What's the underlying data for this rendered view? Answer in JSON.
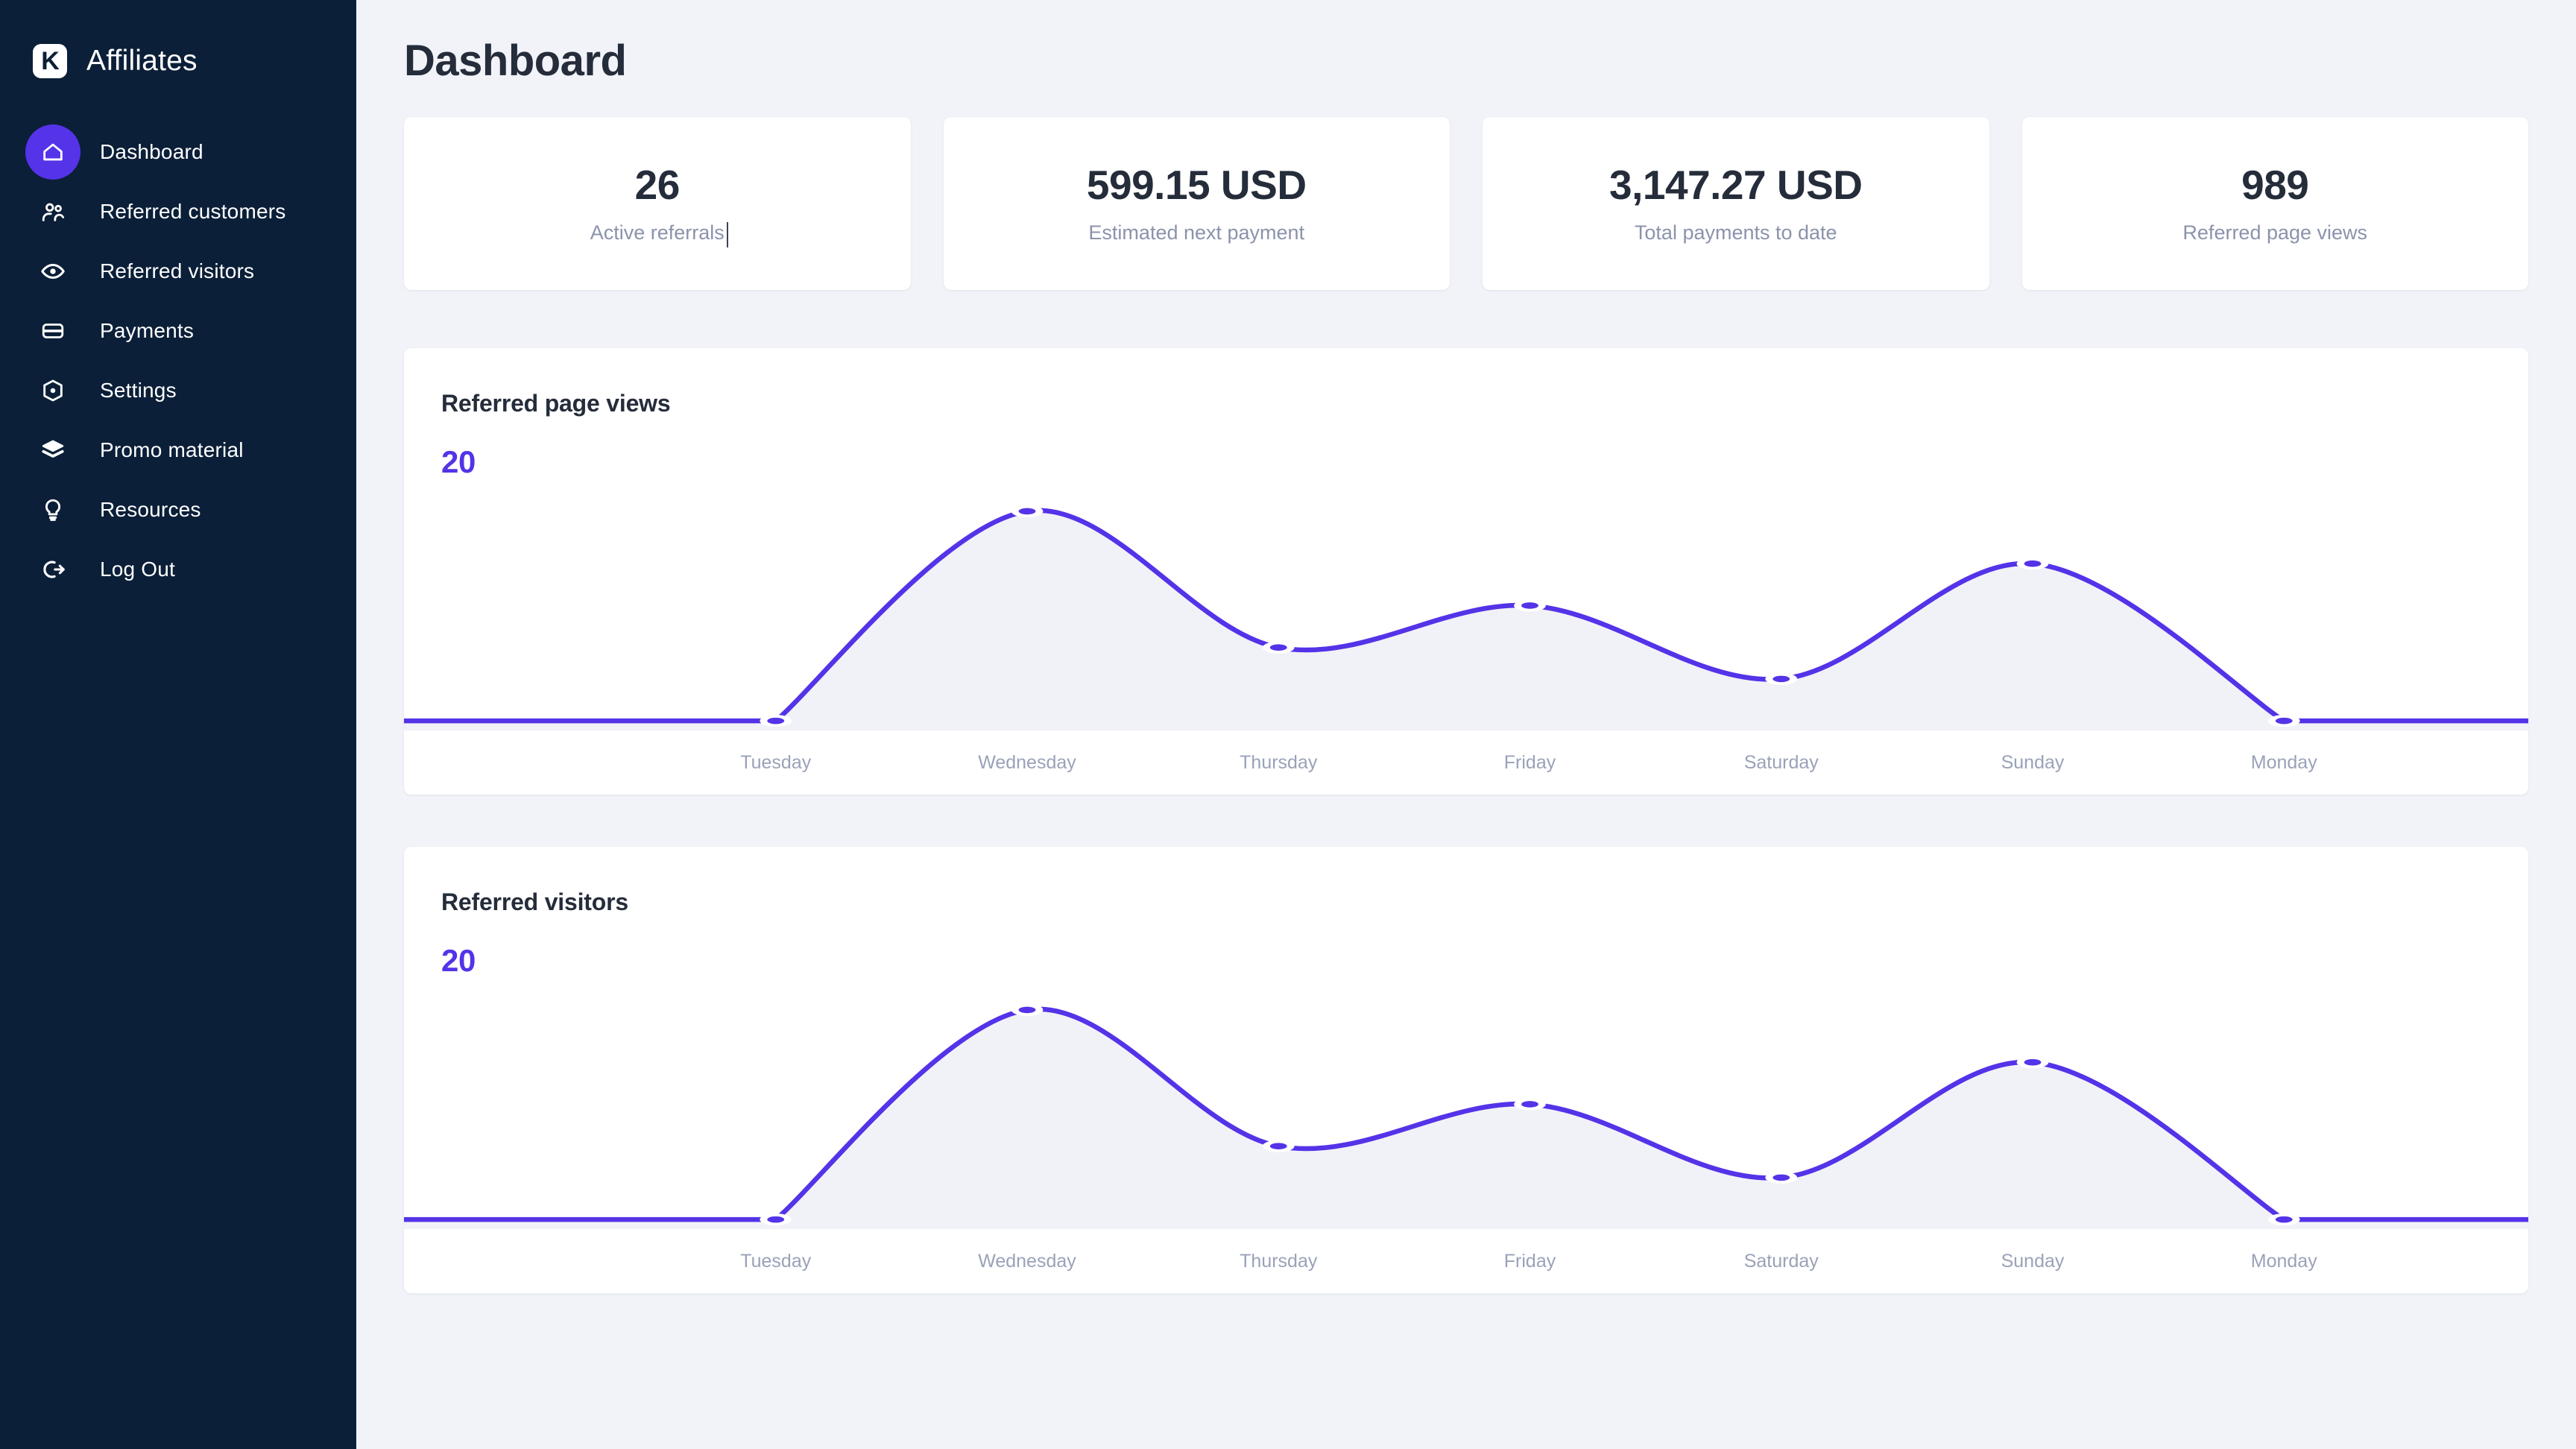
{
  "sidebar": {
    "logo_letter": "K",
    "brand_title": "Affiliates",
    "items": [
      {
        "label": "Dashboard",
        "icon": "home-icon",
        "active": true
      },
      {
        "label": "Referred customers",
        "icon": "users-icon",
        "active": false
      },
      {
        "label": "Referred visitors",
        "icon": "eye-icon",
        "active": false
      },
      {
        "label": "Payments",
        "icon": "credit-card-icon",
        "active": false
      },
      {
        "label": "Settings",
        "icon": "gear-icon",
        "active": false
      },
      {
        "label": "Promo material",
        "icon": "layers-icon",
        "active": false
      },
      {
        "label": "Resources",
        "icon": "lightbulb-icon",
        "active": false
      },
      {
        "label": "Log Out",
        "icon": "logout-icon",
        "active": false
      }
    ]
  },
  "header": {
    "title": "Dashboard"
  },
  "stats": [
    {
      "value": "26",
      "label": "Active referrals",
      "caret": true
    },
    {
      "value": "599.15 USD",
      "label": "Estimated next payment",
      "caret": false
    },
    {
      "value": "3,147.27 USD",
      "label": "Total payments to date",
      "caret": false
    },
    {
      "value": "989",
      "label": "Referred page views",
      "caret": false
    }
  ],
  "colors": {
    "accent": "#5433e8",
    "sidebar_bg": "#0b1f38",
    "page_bg": "#f1f3f8",
    "card_bg": "#ffffff",
    "area_fill": "#f1f2f7",
    "muted_text": "#9aa2b8",
    "heading_text": "#252c3a"
  },
  "charts": [
    {
      "title": "Referred page views",
      "total": "20"
    },
    {
      "title": "Referred visitors",
      "total": "20"
    }
  ],
  "chart_data": [
    {
      "type": "line",
      "title": "Referred page views",
      "total_label": "20",
      "categories": [
        "Tuesday",
        "Wednesday",
        "Thursday",
        "Friday",
        "Saturday",
        "Sunday",
        "Monday"
      ],
      "values": [
        0,
        20,
        7,
        11,
        4,
        15,
        0
      ],
      "xlabel": "",
      "ylabel": "",
      "ylim": [
        0,
        20
      ],
      "grid": false,
      "legend": "none",
      "line_color": "#5433e8",
      "fill_color": "#f1f2f7",
      "marker": "white-ring",
      "curve": "smooth-spline"
    },
    {
      "type": "line",
      "title": "Referred visitors",
      "total_label": "20",
      "categories": [
        "Tuesday",
        "Wednesday",
        "Thursday",
        "Friday",
        "Saturday",
        "Sunday",
        "Monday"
      ],
      "values": [
        0,
        20,
        7,
        11,
        4,
        15,
        0
      ],
      "xlabel": "",
      "ylabel": "",
      "ylim": [
        0,
        20
      ],
      "grid": false,
      "legend": "none",
      "line_color": "#5433e8",
      "fill_color": "#f1f2f7",
      "marker": "white-ring",
      "curve": "smooth-spline"
    }
  ]
}
